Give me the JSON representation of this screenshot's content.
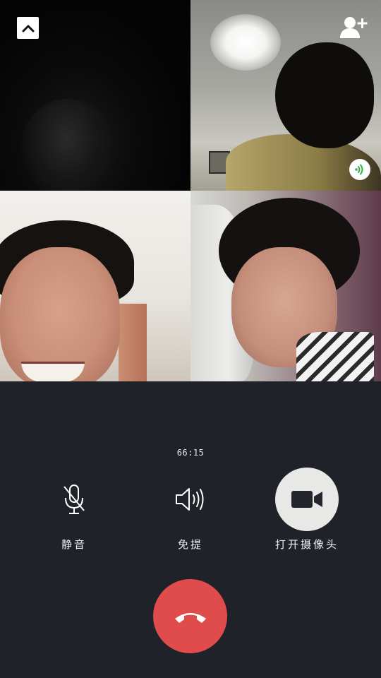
{
  "call": {
    "duration": "66:15"
  },
  "controls": {
    "mute_label": "静音",
    "speaker_label": "免提",
    "camera_label": "打开摄像头"
  },
  "participants": [
    {
      "tile": 1,
      "state": "dark"
    },
    {
      "tile": 2,
      "state": "speaking"
    },
    {
      "tile": 3,
      "state": "video"
    },
    {
      "tile": 4,
      "state": "video"
    }
  ],
  "icons": {
    "collapse": "chevron-up-icon",
    "add_member": "add-user-icon",
    "speaking": "audio-wave-icon",
    "mute": "microphone-off-icon",
    "speaker": "speaker-icon",
    "camera": "video-camera-icon",
    "hangup": "phone-hangup-icon"
  },
  "colors": {
    "background": "#1f2228",
    "hangup": "#e04b4b",
    "speaking_indicator": "#2fb14a",
    "camera_button": "#e8e8e6"
  }
}
